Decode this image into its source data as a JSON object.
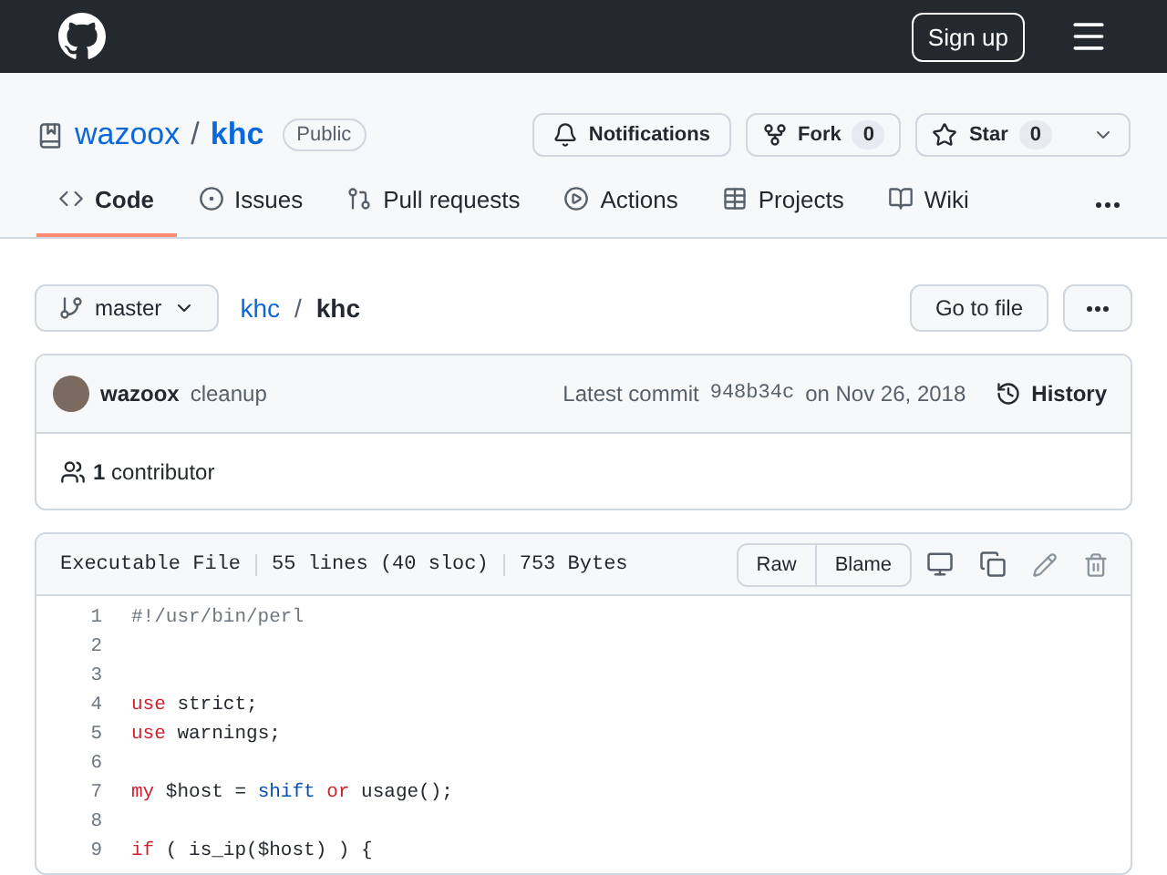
{
  "header": {
    "sign_up": "Sign up"
  },
  "repo": {
    "owner": "wazoox",
    "separator": "/",
    "name": "khc",
    "visibility": "Public",
    "actions": [
      {
        "kind": "notifications",
        "label": "Notifications"
      },
      {
        "kind": "fork",
        "label": "Fork",
        "count": "0"
      },
      {
        "kind": "star",
        "label": "Star",
        "count": "0"
      }
    ]
  },
  "tabs": [
    {
      "kind": "code",
      "label": "Code",
      "selected": true
    },
    {
      "kind": "issues",
      "label": "Issues",
      "selected": false
    },
    {
      "kind": "pulls",
      "label": "Pull requests",
      "selected": false
    },
    {
      "kind": "actions",
      "label": "Actions",
      "selected": false
    },
    {
      "kind": "projects",
      "label": "Projects",
      "selected": false
    },
    {
      "kind": "wiki",
      "label": "Wiki",
      "selected": false
    }
  ],
  "branch": "master",
  "path": {
    "repo": "khc",
    "separator": "/",
    "file": "khc"
  },
  "go_to_file": "Go to file",
  "commit": {
    "author": "wazoox",
    "message": "cleanup",
    "latest_prefix": "Latest commit",
    "sha": "948b34c",
    "date": "on Nov 26, 2018",
    "history": "History"
  },
  "contributors": {
    "count": "1",
    "label": "contributor"
  },
  "file": {
    "mode": "Executable File",
    "lines": "55 lines (40 sloc)",
    "size": "753 Bytes",
    "buttons": [
      "Raw",
      "Blame"
    ]
  },
  "code": [
    {
      "number": "1",
      "tokens": [
        {
          "kind": "comment",
          "text": "#!/usr/bin/perl"
        }
      ]
    },
    {
      "number": "2"
    },
    {
      "number": "3"
    },
    {
      "number": "4",
      "tokens": [
        {
          "kind": "keyword",
          "text": "use"
        },
        {
          "kind": "plain",
          "text": " strict;"
        }
      ]
    },
    {
      "number": "5",
      "tokens": [
        {
          "kind": "keyword",
          "text": "use"
        },
        {
          "kind": "plain",
          "text": " warnings;"
        }
      ]
    },
    {
      "number": "6"
    },
    {
      "number": "7",
      "tokens": [
        {
          "kind": "keyword",
          "text": "my"
        },
        {
          "kind": "plain",
          "text": " $host = "
        },
        {
          "kind": "builtin",
          "text": "shift"
        },
        {
          "kind": "keyword",
          "text": " or"
        },
        {
          "kind": "plain",
          "text": " usage();"
        }
      ]
    },
    {
      "number": "8"
    },
    {
      "number": "9",
      "tokens": [
        {
          "kind": "keyword",
          "text": "if"
        },
        {
          "kind": "plain",
          "text": " ( is_ip($host) ) {"
        }
      ]
    }
  ]
}
